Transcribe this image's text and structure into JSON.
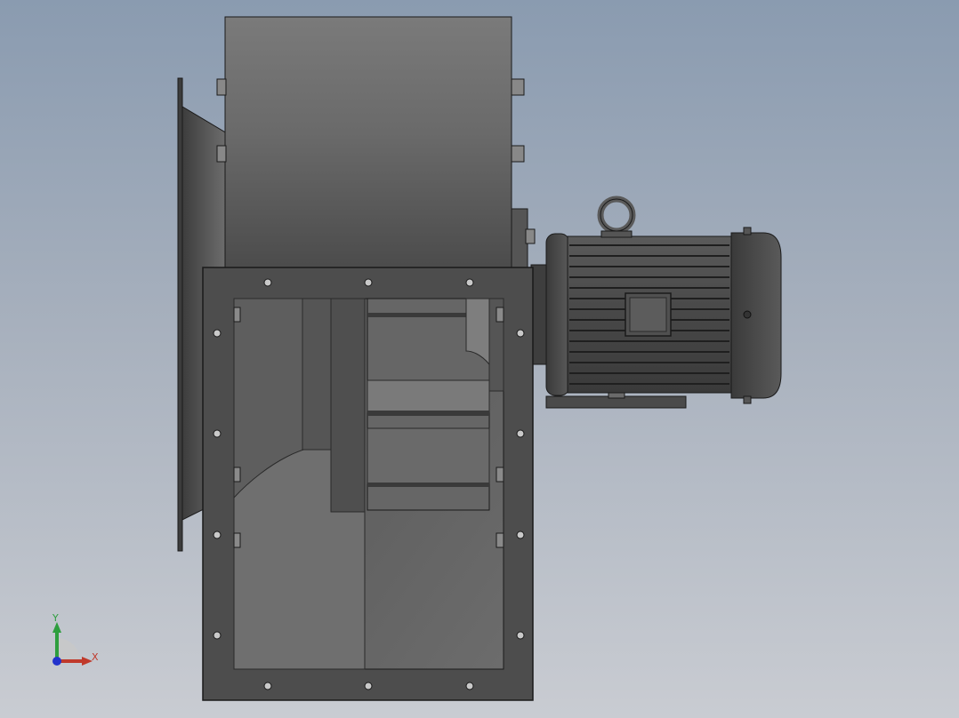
{
  "viewport": {
    "background_top": "#8a9bb0",
    "background_bottom": "#c9ccd2"
  },
  "model": {
    "body_color": "#4d4d4d",
    "edge_color": "#1a1a1a",
    "components": [
      "fan-housing",
      "inlet-cone",
      "outlet-flange",
      "electric-motor",
      "lifting-eye",
      "motor-base"
    ]
  },
  "triad": {
    "x_label": "X",
    "y_label": "Y",
    "x_color": "#c0392b",
    "y_color": "#2e9e3e",
    "z_color": "#2233cc"
  }
}
